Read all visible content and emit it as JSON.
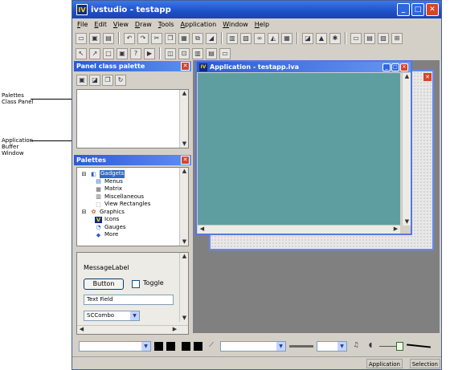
{
  "window": {
    "title": "ivstudio - testapp",
    "app_icon": "IV",
    "min": "_",
    "max": "□",
    "close": "✕"
  },
  "menu": [
    "File",
    "Edit",
    "View",
    "Draw",
    "Tools",
    "Application",
    "Window",
    "Help"
  ],
  "callouts": {
    "palettes_class_panel": [
      "Palettes",
      "Class Panel"
    ],
    "app_buffer_window": [
      "Application",
      "Buffer",
      "Window"
    ]
  },
  "panel_class_palette": {
    "title": "Panel class palette",
    "close": "✕"
  },
  "palettes": {
    "title": "Palettes",
    "close": "✕",
    "tree": [
      {
        "label": "Gadgets",
        "level": 0,
        "expander": "⊟",
        "icon": "gadgets-icon",
        "selected": true
      },
      {
        "label": "Menus",
        "level": 1,
        "icon": "menus-icon"
      },
      {
        "label": "Matrix",
        "level": 1,
        "icon": "matrix-icon"
      },
      {
        "label": "Miscellaneous",
        "level": 1,
        "icon": "miscellaneous-icon"
      },
      {
        "label": "View Rectangles",
        "level": 1,
        "icon": "view-rectangles-icon"
      },
      {
        "label": "Graphics",
        "level": 0,
        "expander": "⊟",
        "icon": "graphics-icon"
      },
      {
        "label": "Icons",
        "level": 1,
        "icon": "icons-icon"
      },
      {
        "label": "Gauges",
        "level": 1,
        "icon": "gauges-icon"
      },
      {
        "label": "More",
        "level": 1,
        "icon": "diamond-icon"
      }
    ]
  },
  "gadget_preview": {
    "message_label": "MessageLabel",
    "button": "Button",
    "toggle": "Toggle",
    "text_field": "Text Field",
    "sc_combo": "SCCombo"
  },
  "app_window": {
    "title": "Application - testapp.iva",
    "canvas_color": "#5f9ea0"
  },
  "statusbar": {
    "application": "Application",
    "selection": "Selection"
  },
  "colors": {
    "title_blue": "#2a5bd7",
    "close_red": "#d6442a"
  }
}
